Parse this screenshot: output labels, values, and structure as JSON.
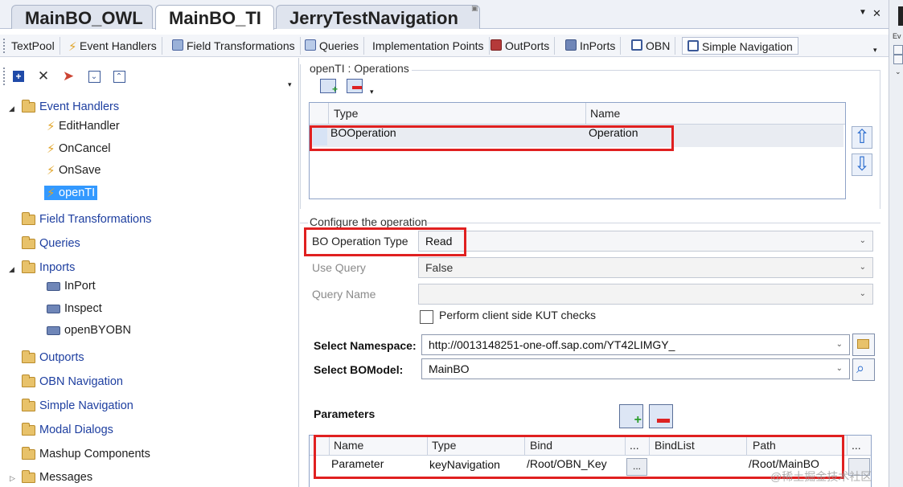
{
  "doc_tabs": [
    {
      "label": "MainBO_OWL",
      "active": false
    },
    {
      "label": "MainBO_TI",
      "active": true
    },
    {
      "label": "JerryTestNavigation",
      "active": false
    }
  ],
  "right_strip": {
    "label": "Ev"
  },
  "toolbar_tabs": [
    {
      "label": "TextPool",
      "icon": "none"
    },
    {
      "label": "Event Handlers",
      "icon": "bolt-icon"
    },
    {
      "label": "Field Transformations",
      "icon": "field-transform-icon"
    },
    {
      "label": "Queries",
      "icon": "query-icon"
    },
    {
      "label": "Implementation Points",
      "icon": "none"
    },
    {
      "label": "OutPorts",
      "icon": "outport-icon"
    },
    {
      "label": "InPorts",
      "icon": "inport-icon"
    },
    {
      "label": "OBN",
      "icon": "obn-icon"
    },
    {
      "label": "Simple Navigation",
      "icon": "simple-navigation-icon"
    }
  ],
  "tree": {
    "event_handlers": {
      "label": "Event Handlers",
      "children": [
        "EditHandler",
        "OnCancel",
        "OnSave",
        "openTI"
      ]
    },
    "field_transformations": "Field Transformations",
    "queries": "Queries",
    "inports": {
      "label": "Inports",
      "children": [
        "InPort",
        "Inspect",
        "openBYOBN"
      ]
    },
    "outports": "Outports",
    "obn_navigation": "OBN Navigation",
    "simple_navigation": "Simple Navigation",
    "modal_dialogs": "Modal Dialogs",
    "mashup_components": "Mashup Components",
    "messages": "Messages"
  },
  "operations": {
    "title": "openTI : Operations",
    "columns": [
      "Type",
      "Name"
    ],
    "rows": [
      {
        "type": "BOOperation",
        "name": "Operation"
      }
    ]
  },
  "configure": {
    "title": "Configure the operation",
    "bo_operation_type_label": "BO Operation Type",
    "bo_operation_type_value": "Read",
    "use_query_label": "Use Query",
    "use_query_value": "False",
    "query_name_label": "Query Name",
    "query_name_value": "",
    "kut_checkbox_label": "Perform client side KUT checks",
    "namespace_label": "Select Namespace:",
    "namespace_value": "http://0013148251-one-off.sap.com/YT42LIMGY_",
    "bomodel_label": "Select BOModel:",
    "bomodel_value": "MainBO"
  },
  "parameters": {
    "title": "Parameters",
    "columns": [
      "Name",
      "Type",
      "Bind",
      "...",
      "BindList",
      "Path",
      "..."
    ],
    "rows": [
      {
        "name": "Parameter",
        "type": "keyNavigation",
        "bind": "/Root/OBN_Key",
        "btn": "...",
        "bindlist": "",
        "path": "/Root/MainBO"
      }
    ]
  },
  "watermark": "@稀土掘金技术社区",
  "colors": {
    "highlight": "#e02020",
    "selection": "#3399ff",
    "link": "#1e3fa0"
  }
}
